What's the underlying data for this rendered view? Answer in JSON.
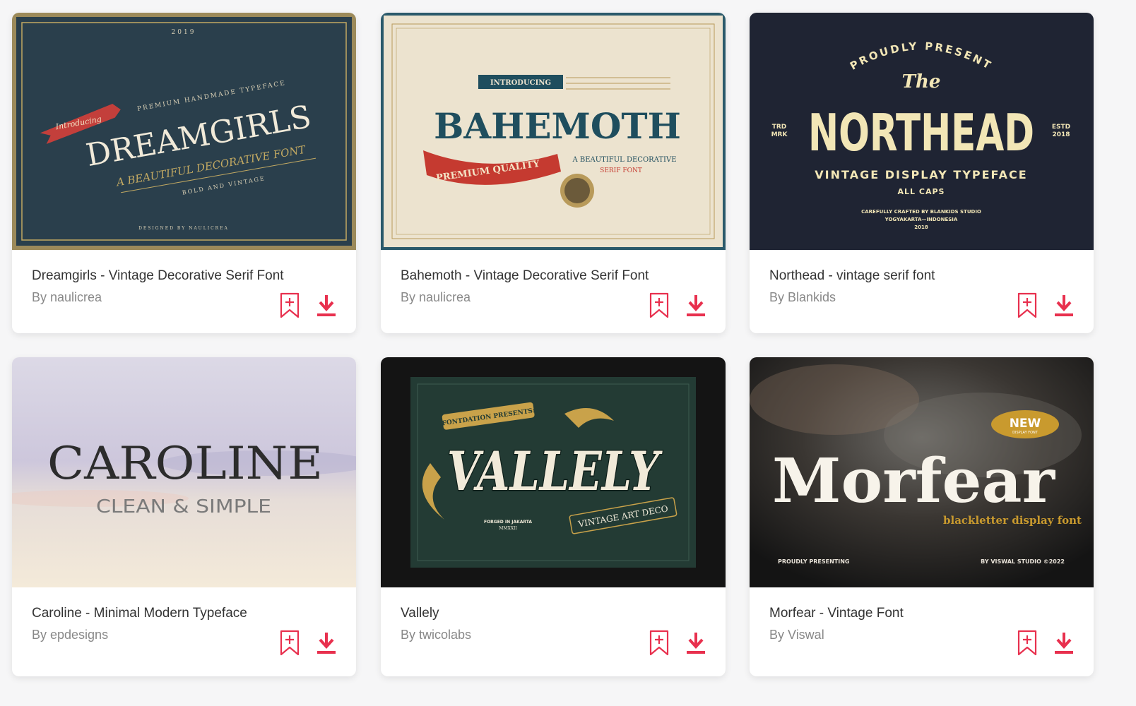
{
  "accent_color": "#e8304e",
  "cards": [
    {
      "title": "Dreamgirls - Vintage Decorative Serif Font",
      "author": "By naulicrea",
      "preview": {
        "year": "2019",
        "badge": "Introducing",
        "tagline": "PREMIUM HANDMADE TYPEFACE",
        "name": "DREAMGIRLS",
        "subtitle": "A BEAUTIFUL DECORATIVE FONT",
        "note": "BOLD AND VINTAGE",
        "credit": "DESIGNED BY NAULICREA"
      }
    },
    {
      "title": "Bahemoth - Vintage Decorative Serif Font",
      "author": "By naulicrea",
      "preview": {
        "badge": "INTRODUCING",
        "name": "BAHEMOTH",
        "ribbon": "PREMIUM QUALITY",
        "subtitle": "A BEAUTIFUL DECORATIVE",
        "subtitle2": "SERIF FONT"
      }
    },
    {
      "title": "Northead - vintage serif font",
      "author": "By Blankids",
      "preview": {
        "arc": "PROUDLY PRESENT",
        "the": "The",
        "name": "NORTHEAD",
        "left_mark": "TRD",
        "left_mark2": "MRK",
        "right_mark": "ESTD",
        "right_mark2": "2018",
        "subtitle": "VINTAGE DISPLAY TYPEFACE",
        "caps": "ALL CAPS",
        "credit": "CAREFULLY CRAFTED BY BLANKIDS STUDIO",
        "credit2": "YOGYAKARTA—INDONESIA",
        "year": "2018"
      }
    },
    {
      "title": "Caroline - Minimal Modern Typeface",
      "author": "By epdesigns",
      "preview": {
        "name": "CAROLINE",
        "subtitle": "CLEAN & SIMPLE"
      }
    },
    {
      "title": "Vallely",
      "author": "By twicolabs",
      "preview": {
        "badge": "FONTDATION PRESENTS:",
        "name": "VALLELY",
        "ribbon": "VINTAGE ART DECO",
        "note": "FORGED IN JAKARTA",
        "note2": "MMXXII"
      }
    },
    {
      "title": "Morfear - Vintage Font",
      "author": "By Viswal",
      "preview": {
        "badge": "NEW",
        "badge_sub": "DISPLAY FONT",
        "name": "Morfear",
        "subtitle": "blackletter display font",
        "left_note": "PROUDLY PRESENTING",
        "right_note": "BY VISWAL STUDIO ©2022"
      }
    }
  ]
}
